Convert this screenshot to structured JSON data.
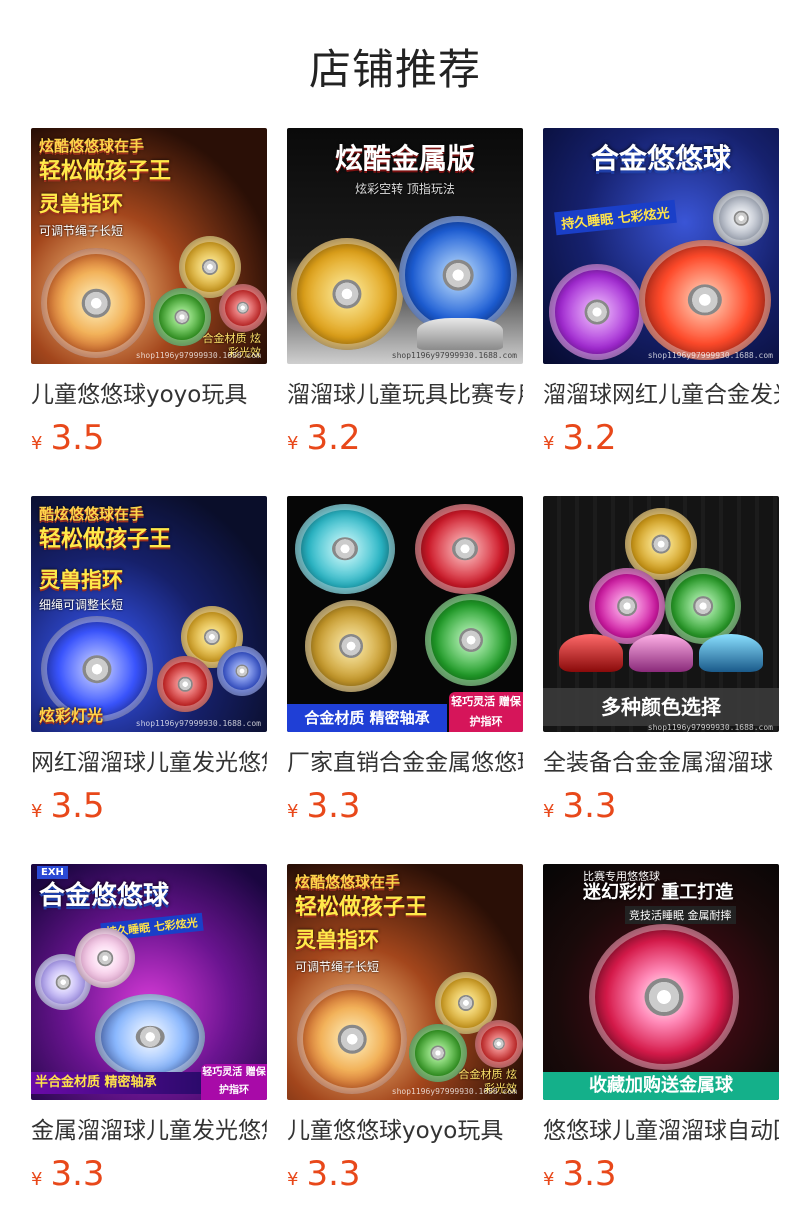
{
  "page": {
    "title": "店铺推荐"
  },
  "products": [
    {
      "name": "儿童悠悠球yoyo玩具",
      "currency": "¥",
      "price": "3.5",
      "image": {
        "headline_1": "炫酷悠悠球在手",
        "headline_2": "轻松做孩子王",
        "headline_3": "灵兽指环",
        "sub": "可调节绳子长短",
        "tag": "合金材质 炫彩光效",
        "watermark": "shop1196y97999930.1688.com",
        "bg": "#3a1a0c"
      }
    },
    {
      "name": "溜溜球儿童玩具比赛专用",
      "currency": "¥",
      "price": "3.2",
      "image": {
        "headline_1": "炫酷金属版",
        "sub": "炫彩空转 顶指玩法",
        "watermark": "shop1196y97999930.1688.com",
        "bg": "#111111"
      }
    },
    {
      "name": "溜溜球网红儿童合金发光",
      "currency": "¥",
      "price": "3.2",
      "image": {
        "headline_1": "合金悠悠球",
        "sub": "持久睡眠 七彩炫光",
        "watermark": "shop1196y97999930.1688.com",
        "bg": "#0d1a5c"
      }
    },
    {
      "name": "网红溜溜球儿童发光悠悠球",
      "currency": "¥",
      "price": "3.5",
      "image": {
        "headline_1": "酷炫悠悠球在手",
        "headline_2": "轻松做孩子王",
        "headline_3": "灵兽指环",
        "sub": "细绳可调整长短",
        "tag": "炫彩灯光",
        "watermark": "shop1196y97999930.1688.com",
        "bg": "#0e1640"
      }
    },
    {
      "name": "厂家直销合金金属悠悠球",
      "currency": "¥",
      "price": "3.3",
      "image": {
        "tag": "合金材质 精密轴承",
        "tag2": "轻巧灵活 赠保护指环",
        "bg": "#0a0a0a"
      }
    },
    {
      "name": "全装备合金金属溜溜球",
      "currency": "¥",
      "price": "3.3",
      "image": {
        "tag": "多种颜色选择",
        "watermark": "shop1196y97999930.1688.com",
        "bg": "#161616"
      }
    },
    {
      "name": "金属溜溜球儿童发光悠悠球",
      "currency": "¥",
      "price": "3.3",
      "image": {
        "badge": "EXH",
        "headline_1": "合金悠悠球",
        "sub": "持久睡眠 七彩炫光",
        "tag": "半合金材质 精密轴承",
        "tag2": "轻巧灵活 赠保护指环",
        "bg": "#4a0f6a"
      }
    },
    {
      "name": "儿童悠悠球yoyo玩具",
      "currency": "¥",
      "price": "3.3",
      "image": {
        "headline_1": "炫酷悠悠球在手",
        "headline_2": "轻松做孩子王",
        "headline_3": "灵兽指环",
        "sub": "可调节绳子长短",
        "tag": "合金材质 炫彩光效",
        "watermark": "shop1196y97999930.1688.com",
        "bg": "#3a1a0c"
      }
    },
    {
      "name": "悠悠球儿童溜溜球自动回旋",
      "currency": "¥",
      "price": "3.3",
      "image": {
        "headline_1": "比赛专用悠悠球",
        "headline_2": "迷幻彩灯 重工打造",
        "sub": "竞技活睡眠 金属耐摔",
        "tag": "收藏加购送金属球",
        "bg": "#0a0a0a"
      }
    }
  ]
}
